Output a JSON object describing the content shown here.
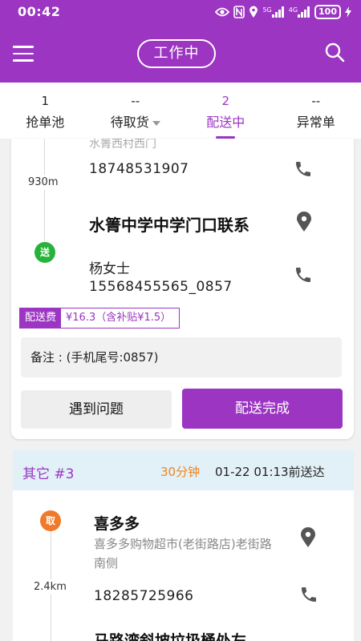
{
  "status_bar": {
    "time": "00:42",
    "signal1": "5G",
    "signal2": "4G",
    "battery": "100"
  },
  "header": {
    "status_button": "工作中"
  },
  "tabs": [
    {
      "count": "1",
      "label": "抢单池"
    },
    {
      "count": "--",
      "label": "待取货"
    },
    {
      "count": "2",
      "label": "配送中"
    },
    {
      "count": "--",
      "label": "异常单"
    }
  ],
  "order1": {
    "pickup_address_partial": "水箐西村西门",
    "pickup_phone": "18748531907",
    "distance": "930m",
    "deliver_badge": "送",
    "recipient_address": "水箐中学中学门口联系",
    "contact_name": "杨女士",
    "contact_phone": "15568455565_0857",
    "fee_label": "配送费",
    "fee_value": "¥16.3（含补贴¥1.5）",
    "remark": "备注 : (手机尾号:0857)",
    "problem_button": "遇到问题",
    "complete_button": "配送完成"
  },
  "order2": {
    "title": "其它 #3",
    "time_limit": "30分钟",
    "eta": "01-22 01:13前送达",
    "pickup_badge": "取",
    "shop_name": "喜多多",
    "shop_address": "喜多多购物超市(老街路店)老街路南侧",
    "distance": "2.4km",
    "shop_phone": "18285725966",
    "next_address_partial": "马路湾斜坡垃圾桶处左"
  },
  "colors": {
    "primary": "#9b35c2",
    "pickup_orange": "#f07a2a",
    "deliver_green": "#27b23a",
    "order_header_bg": "#e2f1f8"
  }
}
